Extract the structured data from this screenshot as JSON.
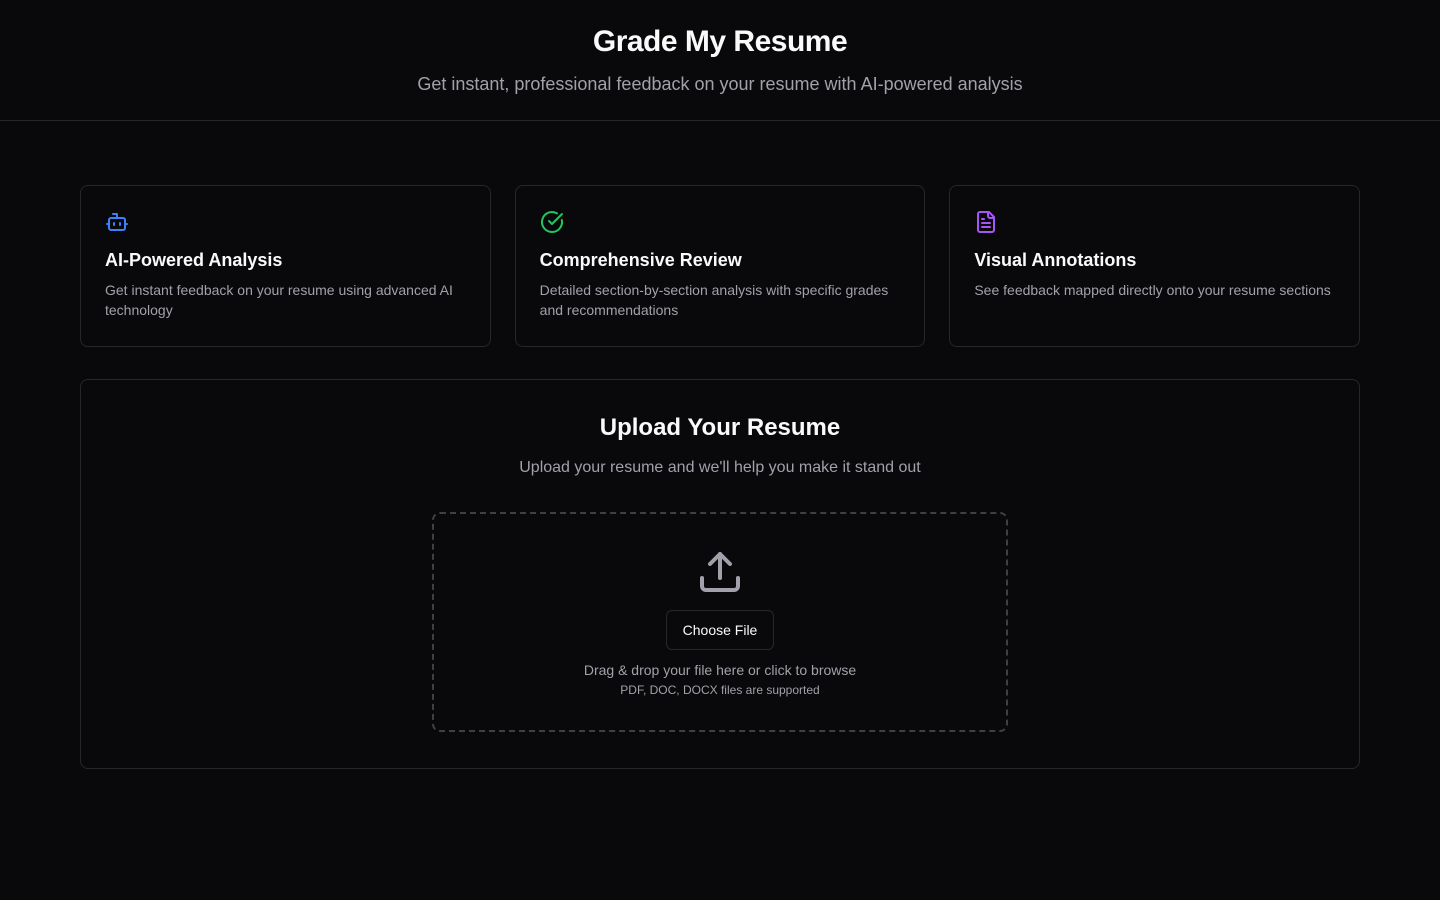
{
  "header": {
    "title": "Grade My Resume",
    "subtitle": "Get instant, professional feedback on your resume with AI-powered analysis"
  },
  "features": [
    {
      "icon": "bot-icon",
      "icon_color": "#3b82f6",
      "title": "AI-Powered Analysis",
      "description": "Get instant feedback on your resume using advanced AI technology"
    },
    {
      "icon": "check-circle-icon",
      "icon_color": "#22c55e",
      "title": "Comprehensive Review",
      "description": "Detailed section-by-section analysis with specific grades and recommendations"
    },
    {
      "icon": "file-text-icon",
      "icon_color": "#a855f7",
      "title": "Visual Annotations",
      "description": "See feedback mapped directly onto your resume sections"
    }
  ],
  "upload": {
    "title": "Upload Your Resume",
    "subtitle": "Upload your resume and we'll help you make it stand out",
    "icon": "upload-icon",
    "button_label": "Choose File",
    "drag_text": "Drag & drop your file here or click to browse",
    "supported_text": "PDF, DOC, DOCX files are supported"
  }
}
